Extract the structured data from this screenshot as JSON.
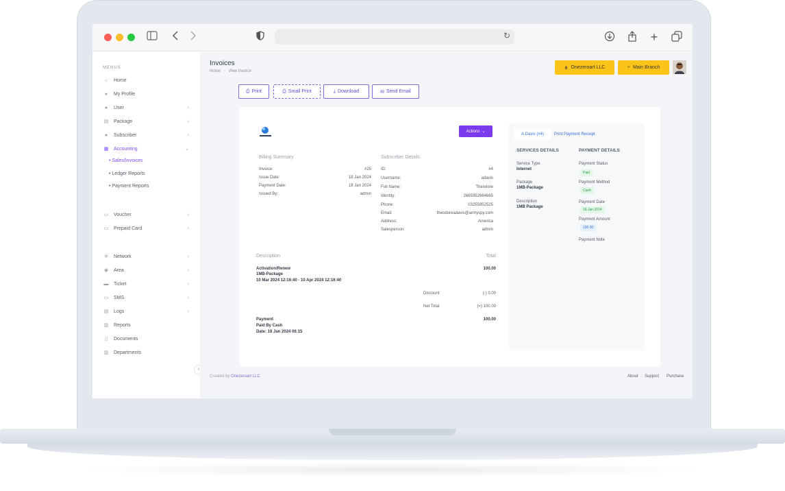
{
  "browser": {
    "back_icon": "chevron-left-icon",
    "forward_icon": "chevron-right-icon"
  },
  "sidebar": {
    "menus_label": "MENUS",
    "items": [
      {
        "label": "Home",
        "icon": "home-icon",
        "has_chevron": false
      },
      {
        "label": "My Profile",
        "icon": "user-icon",
        "has_chevron": false
      },
      {
        "label": "User",
        "icon": "user-icon",
        "has_chevron": true
      },
      {
        "label": "Package",
        "icon": "package-icon",
        "has_chevron": true
      },
      {
        "label": "Subscriber",
        "icon": "users-icon",
        "has_chevron": true
      },
      {
        "label": "Accounting",
        "icon": "calculator-icon",
        "has_chevron": true,
        "active": true
      }
    ],
    "sub_items": [
      {
        "label": "Sales/Invoices",
        "active": true
      },
      {
        "label": "Ledger Reports",
        "active": false
      },
      {
        "label": "Payment Reports",
        "active": false
      }
    ],
    "items2": [
      {
        "label": "Voucher",
        "icon": "voucher-icon"
      },
      {
        "label": "Prepaid Card",
        "icon": "card-icon"
      }
    ],
    "items3": [
      {
        "label": "Network",
        "icon": "network-icon",
        "has_chevron": true
      },
      {
        "label": "Area",
        "icon": "location-icon",
        "has_chevron": true
      },
      {
        "label": "Ticket",
        "icon": "ticket-icon",
        "has_chevron": true
      },
      {
        "label": "SMS",
        "icon": "sms-icon",
        "has_chevron": true
      },
      {
        "label": "Logs",
        "icon": "logs-icon",
        "has_chevron": true
      },
      {
        "label": "Reports",
        "icon": "reports-icon",
        "has_chevron": false
      },
      {
        "label": "Documents",
        "icon": "documents-icon",
        "has_chevron": false
      },
      {
        "label": "Departments",
        "icon": "departments-icon",
        "has_chevron": false
      }
    ]
  },
  "header": {
    "title": "Invoices",
    "breadcrumb_home": "Home",
    "breadcrumb_sep": "-",
    "breadcrumb_current": "View Invoice",
    "company_button": "Onezeroart LLC",
    "branch_button": "Main Branch"
  },
  "actions": {
    "print": "Print",
    "small_print": "Small Print",
    "download": "Download",
    "send_email": "Send Email"
  },
  "invoice": {
    "actions_label": "Actions",
    "billing_title": "Billing Summary",
    "billing": [
      {
        "label": "Invoice:",
        "value": "#25"
      },
      {
        "label": "Issue Date:",
        "value": "18 Jan 2024"
      },
      {
        "label": "Payment Date:",
        "value": "18 Jan 2024"
      },
      {
        "label": "Issued By:",
        "value": "admin"
      }
    ],
    "subscriber_title": "Subscriber Details",
    "subscriber": [
      {
        "label": "ID:",
        "value": "#4"
      },
      {
        "label": "Username:",
        "value": "adavis"
      },
      {
        "label": "Full Name:",
        "value": "Theodore"
      },
      {
        "label": "Identity:",
        "value": "2665952664665"
      },
      {
        "label": "Phone:",
        "value": "03255952525"
      },
      {
        "label": "Email:",
        "value": "theodoreadavis@armyspy.com"
      },
      {
        "label": "Address:",
        "value": "America"
      },
      {
        "label": "Salesperson:",
        "value": "admin"
      }
    ],
    "desc_title": "Description",
    "total_title": "Total",
    "line1_title": "Activation/Renew",
    "line1_package": "1MB-Package",
    "line1_dates": "10 Mar 2024 12:16:40 - 10 Apr 2024 12:16:40",
    "line1_total": "100.00",
    "discount_label": "Discount",
    "discount_value": "(-) 0.00",
    "net_label": "Net Total",
    "net_value": "(=) 100.00",
    "payment_title": "Payment",
    "payment_by": "Paid By Cash",
    "payment_date": "Date: 18 Jan 2024 06:15",
    "payment_total": "100.00"
  },
  "side_panel": {
    "tab_user": "A.Davis (#4)",
    "tab_receipt": "Print Payment Receipt",
    "services_title": "SERVICES DETAILS",
    "payment_title": "PAYMENT DETAILS",
    "service_type_label": "Service Type",
    "service_type_value": "Internet",
    "package_label": "Package",
    "package_value": "1MB-Package",
    "description_label": "Description",
    "description_value": "1MB Package",
    "status_label": "Payment Status",
    "status_value": "Paid",
    "method_label": "Payment Method",
    "method_value": "Cash",
    "date_label": "Payment Date",
    "date_value": "18 Jan 2024",
    "amount_label": "Payment Amount",
    "amount_value": "100.00",
    "note_label": "Payment Note"
  },
  "footer": {
    "created_by": "Created by",
    "company": "Onezeroart LLC",
    "about": "About",
    "support": "Support",
    "purchase": "Purchase"
  },
  "colors": {
    "accent": "#7c3aed",
    "header_button": "#fcc419"
  }
}
